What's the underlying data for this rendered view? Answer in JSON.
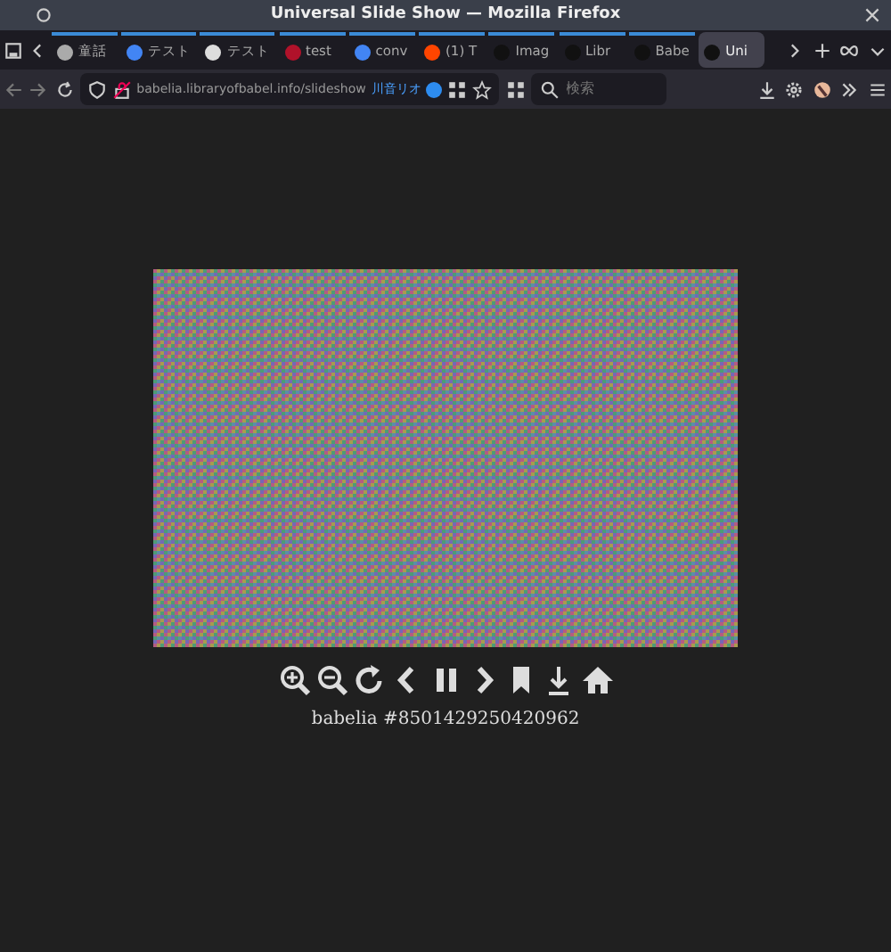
{
  "window": {
    "title": "Universal Slide Show — Mozilla Firefox"
  },
  "tabs": [
    {
      "label": "童話",
      "selected": false,
      "color": "#aaaaaa"
    },
    {
      "label": "テスト",
      "selected": false,
      "color": "#4285f4"
    },
    {
      "label": "テスト",
      "selected": false,
      "color": "#dddddd"
    },
    {
      "label": "test",
      "selected": false,
      "color": "#b0122a"
    },
    {
      "label": "conv",
      "selected": false,
      "color": "#4285f4"
    },
    {
      "label": "(1) T",
      "selected": false,
      "color": "#ff4500"
    },
    {
      "label": "Imag",
      "selected": false,
      "color": "#111111"
    },
    {
      "label": "Libr",
      "selected": false,
      "color": "#111111"
    },
    {
      "label": "Babe",
      "selected": false,
      "color": "#111111"
    },
    {
      "label": "Uni",
      "selected": true,
      "color": "#111111"
    }
  ],
  "address": {
    "url": "babelia.libraryofbabel.info/slideshow",
    "extra": "川音リオ"
  },
  "search": {
    "placeholder": "検索"
  },
  "slide": {
    "kind": "picture",
    "caption": "babelia #8501429250420962"
  }
}
